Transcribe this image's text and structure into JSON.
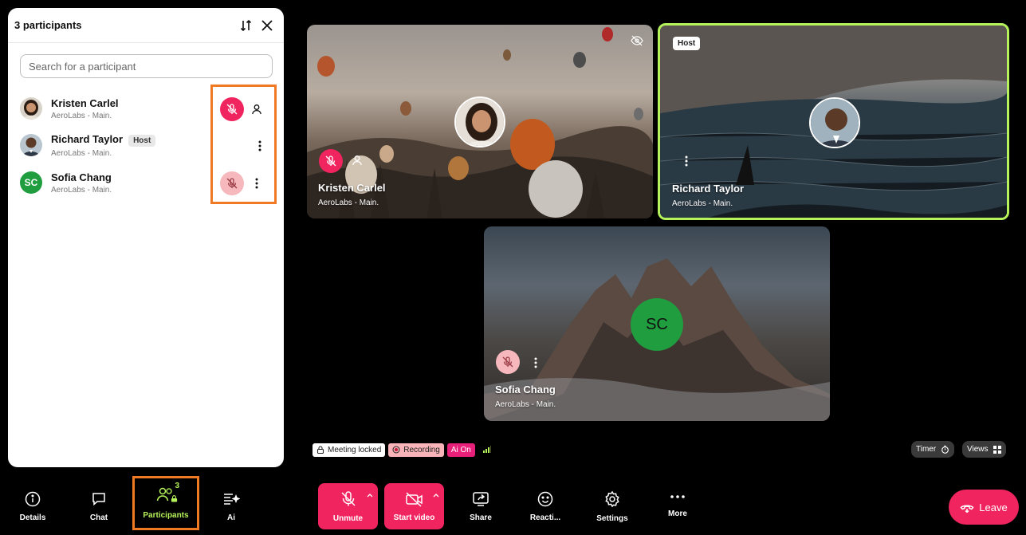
{
  "panel": {
    "title": "3 participants",
    "search_placeholder": "Search for a participant",
    "participants": [
      {
        "name": "Kristen Carlel",
        "sub": "AeroLabs - Main.",
        "badge": ""
      },
      {
        "name": "Richard Taylor",
        "sub": "AeroLabs - Main.",
        "badge": "Host"
      },
      {
        "name": "Sofia Chang",
        "sub": "AeroLabs - Main.",
        "badge": "",
        "initials": "SC"
      }
    ]
  },
  "tiles": [
    {
      "name": "Kristen Carlel",
      "sub": "AeroLabs - Main."
    },
    {
      "name": "Richard Taylor",
      "sub": "AeroLabs - Main.",
      "badge": "Host"
    },
    {
      "name": "Sofia Chang",
      "sub": "AeroLabs - Main.",
      "initials": "SC"
    }
  ],
  "status": {
    "locked": "Meeting locked",
    "recording": "Recording",
    "ai": "Ai On",
    "timer": "Timer",
    "views": "Views"
  },
  "toolbar": {
    "details": "Details",
    "chat": "Chat",
    "participants": "Participants",
    "participants_count": "3",
    "ai": "Ai",
    "unmute": "Unmute",
    "start_video": "Start video",
    "share": "Share",
    "reactions": "Reacti...",
    "settings": "Settings",
    "more": "More",
    "leave": "Leave"
  },
  "colors": {
    "accent_red": "#f0245f",
    "host_border": "#b6f35a",
    "highlight": "#f07a24",
    "participants_active": "#b6f35a"
  }
}
